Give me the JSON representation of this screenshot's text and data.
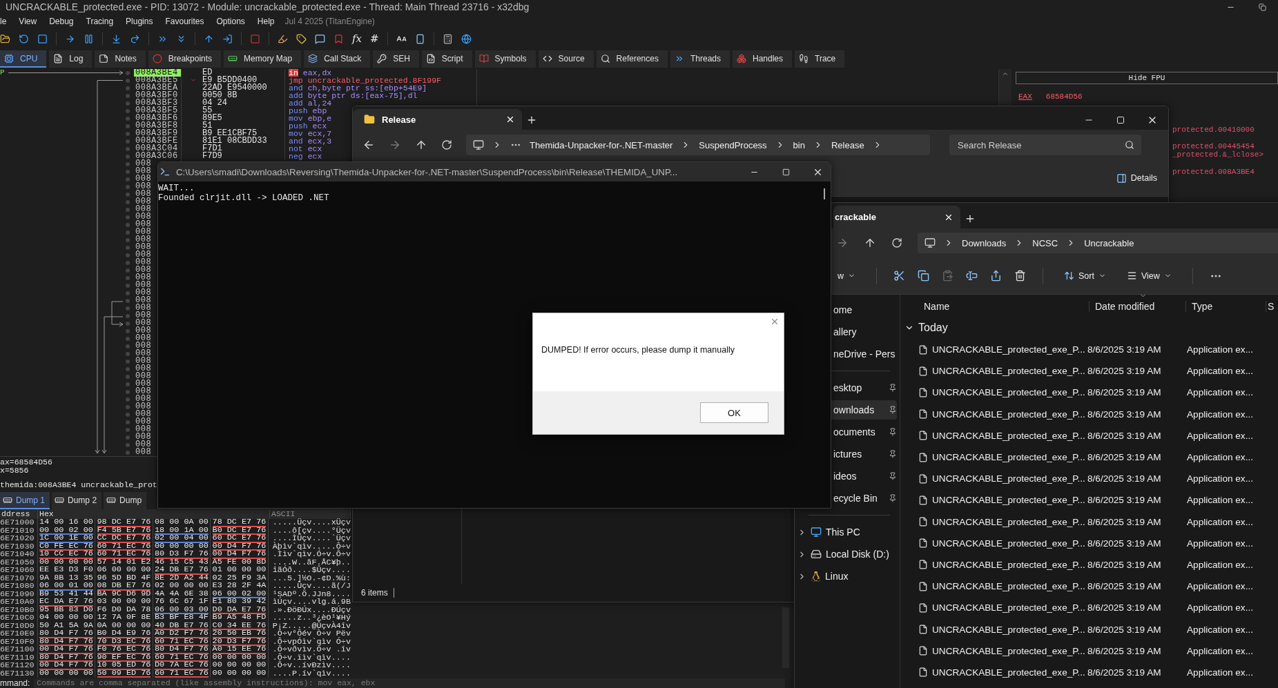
{
  "debugger": {
    "title": "UNCRACKABLE_protected.exe - PID: 13072 - Module: uncrackable_protected.exe - Thread: Main Thread 23716 - x32dbg",
    "menu": [
      "le",
      "View",
      "Debug",
      "Tracing",
      "Plugins",
      "Favourites",
      "Options",
      "Help"
    ],
    "build": "Jul 4 2025 (TitanEngine)",
    "toolbar_glyphs": [
      "fx",
      "#"
    ],
    "tabs": [
      {
        "label": "CPU",
        "selected": true
      },
      {
        "label": "Log",
        "selected": false
      },
      {
        "label": "Notes",
        "selected": false
      },
      {
        "label": "Breakpoints",
        "selected": false
      },
      {
        "label": "Memory Map",
        "selected": false
      },
      {
        "label": "Call Stack",
        "selected": false
      },
      {
        "label": "SEH",
        "selected": false
      },
      {
        "label": "Script",
        "selected": false
      },
      {
        "label": "Symbols",
        "selected": false
      },
      {
        "label": "Source",
        "selected": false
      },
      {
        "label": "References",
        "selected": false
      },
      {
        "label": "Threads",
        "selected": false
      },
      {
        "label": "Handles",
        "selected": false
      },
      {
        "label": "Trace",
        "selected": false
      }
    ],
    "eip_label": "P",
    "disassembly": [
      {
        "address": "008A3BE4",
        "bytes": "ED",
        "mnemonic": "in",
        "operands": "eax,dx",
        "kind": "io",
        "selected": true
      },
      {
        "address": "008A3BE5",
        "bytes": "E9 B5DD0400",
        "mnemonic": "jmp",
        "operands": "uncrackable_protected.8F199F",
        "kind": "jump",
        "selected": false
      },
      {
        "address": "008A3BEA",
        "bytes": "22AD E9540000",
        "mnemonic": "and",
        "operands": "ch,byte ptr ss:[ebp+54E9]",
        "kind": "normal",
        "selected": false
      },
      {
        "address": "008A3BF0",
        "bytes": "0050 8B",
        "mnemonic": "add",
        "operands": "byte ptr ds:[eax-75],dl",
        "kind": "normal",
        "selected": false
      },
      {
        "address": "008A3BF3",
        "bytes": "04 24",
        "mnemonic": "add",
        "operands": "al,24",
        "kind": "normal",
        "selected": false
      },
      {
        "address": "008A3BF5",
        "bytes": "55",
        "mnemonic": "push",
        "operands": "ebp",
        "kind": "normal",
        "selected": false
      },
      {
        "address": "008A3BF6",
        "bytes": "89E5",
        "mnemonic": "mov",
        "operands": "ebp,e",
        "kind": "normal",
        "selected": false
      },
      {
        "address": "008A3BF8",
        "bytes": "51",
        "mnemonic": "push",
        "operands": "ecx",
        "kind": "normal",
        "selected": false
      },
      {
        "address": "008A3BF9",
        "bytes": "B9 EE1CBF75",
        "mnemonic": "mov",
        "operands": "ecx,7",
        "kind": "normal",
        "selected": false
      },
      {
        "address": "008A3BFE",
        "bytes": "81E1 08CBDD33",
        "mnemonic": "and",
        "operands": "ecx,3",
        "kind": "normal",
        "selected": false
      },
      {
        "address": "008A3C04",
        "bytes": "F7D1",
        "mnemonic": "not",
        "operands": "ecx",
        "kind": "normal",
        "selected": false
      },
      {
        "address": "008A3C06",
        "bytes": "F7D9",
        "mnemonic": "neg",
        "operands": "ecx",
        "kind": "normal",
        "selected": false
      },
      {
        "address": "008",
        "selected": false
      },
      {
        "address": "008",
        "selected": false
      },
      {
        "address": "008",
        "selected": false
      },
      {
        "address": "008",
        "selected": false
      },
      {
        "address": "008",
        "selected": false
      },
      {
        "address": "008",
        "selected": false
      },
      {
        "address": "008",
        "selected": false
      },
      {
        "address": "008",
        "selected": false
      },
      {
        "address": "008",
        "selected": false
      },
      {
        "address": "008",
        "selected": false
      },
      {
        "address": "008",
        "selected": false
      },
      {
        "address": "008",
        "selected": false
      },
      {
        "address": "008",
        "selected": false
      },
      {
        "address": "008",
        "selected": false
      },
      {
        "address": "008",
        "selected": false
      },
      {
        "address": "008",
        "selected": false
      },
      {
        "address": "008",
        "selected": false
      },
      {
        "address": "008",
        "selected": false
      },
      {
        "address": "008",
        "selected": false
      },
      {
        "address": "008",
        "selected": false
      },
      {
        "address": "008",
        "selected": false
      },
      {
        "address": "008",
        "selected": false
      },
      {
        "address": "008",
        "selected": false
      },
      {
        "address": "008",
        "selected": false
      },
      {
        "address": "008",
        "selected": false
      },
      {
        "address": "008",
        "selected": false
      },
      {
        "address": "008",
        "selected": false
      },
      {
        "address": "008",
        "selected": false
      },
      {
        "address": "008",
        "selected": false
      },
      {
        "address": "008",
        "selected": false
      },
      {
        "address": "008",
        "selected": false
      },
      {
        "address": "008",
        "selected": false
      },
      {
        "address": "008",
        "selected": false
      },
      {
        "address": "008",
        "selected": false
      },
      {
        "address": "008",
        "selected": false
      },
      {
        "address": "008",
        "selected": false
      },
      {
        "address": "008",
        "selected": false
      },
      {
        "address": "008",
        "selected": false
      },
      {
        "address": "008",
        "selected": false
      }
    ],
    "registers": {
      "header": "Hide FPU",
      "name": "EAX",
      "value": "68584D56",
      "comments": [
        "protected.00410000",
        "protected.00445454",
        "_protected.&_lclose>",
        "protected.008A3BE4"
      ]
    },
    "info_lines": [
      "ax=68584D56",
      "x=5856",
      "themida:008A3BE4 uncrackable_prot"
    ],
    "dump_tabs": [
      {
        "label": "Dump 1",
        "selected": true
      },
      {
        "label": "Dump 2",
        "selected": false
      },
      {
        "label": "Dump",
        "selected": false
      }
    ],
    "dump": {
      "columns": [
        "ddress",
        "Hex",
        "ASCII"
      ],
      "rows": [
        {
          "address": "6E71000",
          "groups": [
            {
              "hex": "14 00 16 00"
            },
            {
              "hex": "98 DC E7 76",
              "color": "#e04a4a"
            },
            {
              "hex": "08 00 0A 00"
            },
            {
              "hex": "78 DC E7 76",
              "color": "#e04a4a"
            }
          ],
          "ascii": ".....Üçv....xÜçv"
        },
        {
          "address": "6E71010",
          "groups": [
            {
              "hex": "00 00 02 00",
              "color": "#5a7fd6"
            },
            {
              "hex": "F4 5B E7 76",
              "color": "#e04a4a"
            },
            {
              "hex": "18 00 1A 00",
              "color": "#5a7fd6"
            },
            {
              "hex": "B0 DC E7 76",
              "color": "#e04a4a"
            }
          ],
          "ascii": "....ô[çv....°Üçv"
        },
        {
          "address": "6E71020",
          "groups": [
            {
              "hex": "1C 00 1E 00",
              "color": "#5a7fd6"
            },
            {
              "hex": "CC DC E7 76",
              "color": "#e04a4a"
            },
            {
              "hex": "02 00 04 00",
              "color": "#5a7fd6"
            },
            {
              "hex": "60 DC E7 76",
              "color": "#e04a4a"
            }
          ],
          "ascii": "....ÌÜçv....`Üçv"
        },
        {
          "address": "6E71030",
          "groups": [
            {
              "hex": "C0 FE EC 76",
              "color": "#e04a4a"
            },
            {
              "hex": "60 71 EC 76",
              "color": "#e04a4a"
            },
            {
              "hex": "00 00 00 00"
            },
            {
              "hex": "00 D4 F7 76",
              "color": "#e04a4a"
            }
          ],
          "ascii": "Àþìv`qìv.....Ô÷v"
        },
        {
          "address": "6E71040",
          "groups": [
            {
              "hex": "10 CC EC 76",
              "color": "#e04a4a"
            },
            {
              "hex": "60 71 EC 76",
              "color": "#e04a4a"
            },
            {
              "hex": "80 D3 F7 76",
              "color": "#e04a4a"
            },
            {
              "hex": "00 D4 F7 76",
              "color": "#e04a4a"
            }
          ],
          "ascii": ".Ììv`qìv.Ó÷v.Ô÷v"
        },
        {
          "address": "6E71050",
          "groups": [
            {
              "hex": "00 00 00 00"
            },
            {
              "hex": "57 14 01 E2"
            },
            {
              "hex": "46 15 C5 43"
            },
            {
              "hex": "A5 FE 00 8D"
            }
          ],
          "ascii": "....W..âF.ÅC¥þ.."
        },
        {
          "address": "6E71060",
          "groups": [
            {
              "hex": "EE E3 D3 F0"
            },
            {
              "hex": "06 00 00 00"
            },
            {
              "hex": "24 DB E7 76",
              "color": "#e04a4a"
            },
            {
              "hex": "01 00 00 00"
            }
          ],
          "ascii": "îãÓð....$Ûçv...."
        },
        {
          "address": "6E71070",
          "groups": [
            {
              "hex": "9A 8B 13 35"
            },
            {
              "hex": "96 5D BD 4F"
            },
            {
              "hex": "8E 2D A2 44"
            },
            {
              "hex": "02 25 F9 3A"
            }
          ],
          "ascii": "...5.]½O.-¢D.%ù:"
        },
        {
          "address": "6E71080",
          "groups": [
            {
              "hex": "06 00 01 00",
              "color": "#5a7fd6"
            },
            {
              "hex": "08 DB E7 76",
              "color": "#e04a4a"
            },
            {
              "hex": "02 00 00 00"
            },
            {
              "hex": "E3 28 2F 4A"
            }
          ],
          "ascii": ".....Ûçv....ã(/J"
        },
        {
          "address": "6E71090",
          "groups": [
            {
              "hex": "B9 53 41 44"
            },
            {
              "hex": "BA 9C D6 9D"
            },
            {
              "hex": "4A 4A 6E 38"
            },
            {
              "hex": "06 00 02 00",
              "color": "#5a7fd6"
            }
          ],
          "ascii": "¹SADº.Ö.JJn8...."
        },
        {
          "address": "6E710A0",
          "groups": [
            {
              "hex": "EC DA E7 76",
              "color": "#e04a4a"
            },
            {
              "hex": "03 00 00 00"
            },
            {
              "hex": "76 6C 67 1F"
            },
            {
              "hex": "E1 80 39 42"
            }
          ],
          "ascii": "ìÚçv....vlg.á.9B"
        },
        {
          "address": "6E710B0",
          "groups": [
            {
              "hex": "95 BB 83 D0"
            },
            {
              "hex": "F6 D0 DA 78"
            },
            {
              "hex": "06 00 03 00",
              "color": "#5a7fd6"
            },
            {
              "hex": "D0 DA E7 76",
              "color": "#e04a4a"
            }
          ],
          "ascii": ".».ÐöÐÚx....ÐÚçv"
        },
        {
          "address": "6E710C0",
          "groups": [
            {
              "hex": "04 00 00 00"
            },
            {
              "hex": "12 7A 0F 8E"
            },
            {
              "hex": "B3 BF E8 4F"
            },
            {
              "hex": "B9 A5 48 FD"
            }
          ],
          "ascii": ".....z..³¿èO¹¥Hý"
        },
        {
          "address": "6E710D0",
          "groups": [
            {
              "hex": "50 A1 5A 9A"
            },
            {
              "hex": "0A 00 00 00"
            },
            {
              "hex": "40 DB E7 76",
              "color": "#e04a4a"
            },
            {
              "hex": "C0 34 EE 76",
              "color": "#e04a4a"
            }
          ],
          "ascii": "P¡Z.....@ÛçvÀ4îv"
        },
        {
          "address": "6E710E0",
          "groups": [
            {
              "hex": "80 D4 F7 76",
              "color": "#e04a4a"
            },
            {
              "hex": "B0 D4 E9 76",
              "color": "#e04a4a"
            },
            {
              "hex": "A0 D2 F7 76",
              "color": "#e04a4a"
            },
            {
              "hex": "20 50 EB 76",
              "color": "#e04a4a"
            }
          ],
          "ascii": ".Ô÷v°Ôév Ò÷v Pëv"
        },
        {
          "address": "6E710F0",
          "groups": [
            {
              "hex": "80 D4 F7 76",
              "color": "#e04a4a"
            },
            {
              "hex": "70 D3 EC 76",
              "color": "#e04a4a"
            },
            {
              "hex": "60 71 EC 76",
              "color": "#e04a4a"
            },
            {
              "hex": "20 D3 F7 76",
              "color": "#e04a4a"
            }
          ],
          "ascii": ".Ô÷vpÓìv`qìv Ó÷v"
        },
        {
          "address": "6E71100",
          "groups": [
            {
              "hex": "00 D4 F7 76",
              "color": "#e04a4a"
            },
            {
              "hex": "F0 76 EC 76",
              "color": "#e04a4a"
            },
            {
              "hex": "80 D4 F7 76",
              "color": "#e04a4a"
            },
            {
              "hex": "A0 15 EE 76",
              "color": "#e04a4a"
            }
          ],
          "ascii": ".Ô÷vðvìv.Ô÷v .îv"
        },
        {
          "address": "6E71110",
          "groups": [
            {
              "hex": "80 D4 F7 76",
              "color": "#e04a4a"
            },
            {
              "hex": "90 EF EC 76",
              "color": "#e04a4a"
            },
            {
              "hex": "60 71 EC 76",
              "color": "#e04a4a"
            },
            {
              "hex": "00 00 00 00"
            }
          ],
          "ascii": ".Ô÷v.ïìv`qìv...."
        },
        {
          "address": "6E71120",
          "groups": [
            {
              "hex": "00 D4 F7 76",
              "color": "#e04a4a"
            },
            {
              "hex": "10 05 ED 76",
              "color": "#e04a4a"
            },
            {
              "hex": "D0 7A EC 76",
              "color": "#e04a4a"
            },
            {
              "hex": "00 00 00 00"
            }
          ],
          "ascii": ".Ô÷v..ívÐzìv...."
        },
        {
          "address": "6E71130",
          "groups": [
            {
              "hex": "00 00 00 00"
            },
            {
              "hex": "50 09 ED 76",
              "color": "#e04a4a"
            },
            {
              "hex": "60 71 EC 76",
              "color": "#e04a4a"
            },
            {
              "hex": "00 00 00 00"
            }
          ],
          "ascii": "....P.ív`qìv...."
        }
      ]
    },
    "command": {
      "label": "mmand:",
      "placeholder": "Commands are comma separated (like assembly instructions): mov eax, ebx"
    }
  },
  "release_window": {
    "tab": "Release",
    "path": [
      "Themida-Unpacker-for-.NET-master",
      "SuspendProcess",
      "bin",
      "Release"
    ],
    "search": {
      "placeholder": "Search Release"
    },
    "details": "Details",
    "status": "6 items"
  },
  "uncrackable_window": {
    "tab": "crackable",
    "path": [
      "Downloads",
      "NCSC",
      "Uncrackable"
    ],
    "new_label": "w",
    "sort": "Sort",
    "view": "View",
    "nav_top": [
      {
        "label": "ome",
        "pinned": false,
        "selected": false
      },
      {
        "label": "allery",
        "pinned": false,
        "selected": false
      },
      {
        "label": "neDrive - Pers",
        "pinned": false,
        "selected": false
      },
      {
        "label": "esktop",
        "pinned": true,
        "selected": false
      },
      {
        "label": "ownloads",
        "pinned": true,
        "selected": true
      },
      {
        "label": "ocuments",
        "pinned": true,
        "selected": false
      },
      {
        "label": "ictures",
        "pinned": true,
        "selected": false
      },
      {
        "label": "ideos",
        "pinned": true,
        "selected": false
      },
      {
        "label": "ecycle Bin",
        "pinned": true,
        "selected": false
      }
    ],
    "nav_bottom": [
      {
        "label": "This PC",
        "kind": "pc"
      },
      {
        "label": "Local Disk (D:)",
        "kind": "disk"
      },
      {
        "label": "Linux",
        "kind": "linux"
      }
    ],
    "columns": [
      "Name",
      "Date modified",
      "Type",
      "S"
    ],
    "group": "Today",
    "files": [
      {
        "name": "UNCRACKABLE_protected_exe_P...",
        "date": "8/6/2025 3:19 AM",
        "type": "Application ex..."
      },
      {
        "name": "UNCRACKABLE_protected_exe_P...",
        "date": "8/6/2025 3:19 AM",
        "type": "Application ex..."
      },
      {
        "name": "UNCRACKABLE_protected_exe_P...",
        "date": "8/6/2025 3:19 AM",
        "type": "Application ex..."
      },
      {
        "name": "UNCRACKABLE_protected_exe_P...",
        "date": "8/6/2025 3:19 AM",
        "type": "Application ex..."
      },
      {
        "name": "UNCRACKABLE_protected_exe_P...",
        "date": "8/6/2025 3:19 AM",
        "type": "Application ex..."
      },
      {
        "name": "UNCRACKABLE_protected_exe_P...",
        "date": "8/6/2025 3:19 AM",
        "type": "Application ex..."
      },
      {
        "name": "UNCRACKABLE_protected_exe_P...",
        "date": "8/6/2025 3:19 AM",
        "type": "Application ex..."
      },
      {
        "name": "UNCRACKABLE_protected_exe_P...",
        "date": "8/6/2025 3:19 AM",
        "type": "Application ex..."
      },
      {
        "name": "UNCRACKABLE_protected_exe_P...",
        "date": "8/6/2025 3:19 AM",
        "type": "Application ex..."
      },
      {
        "name": "UNCRACKABLE_protected_exe_P...",
        "date": "8/6/2025 3:19 AM",
        "type": "Application ex..."
      },
      {
        "name": "UNCRACKABLE_protected_exe_P...",
        "date": "8/6/2025 3:19 AM",
        "type": "Application ex..."
      },
      {
        "name": "UNCRACKABLE_protected_exe_P...",
        "date": "8/6/2025 3:19 AM",
        "type": "Application ex..."
      },
      {
        "name": "UNCRACKABLE_protected_exe_P...",
        "date": "8/6/2025 3:19 AM",
        "type": "Application ex..."
      },
      {
        "name": "UNCRACKABLE_protected_exe_P...",
        "date": "8/6/2025 3:19 AM",
        "type": "Application ex..."
      },
      {
        "name": "UNCRACKABLE_protected_exe_P...",
        "date": "8/6/2025 3:19 AM",
        "type": "Application ex..."
      },
      {
        "name": "UNCRACKABLE_protected_exe_P...",
        "date": "8/6/2025 3:19 AM",
        "type": "Application ex..."
      }
    ]
  },
  "console": {
    "title": "C:\\Users\\smadi\\Downloads\\Reversing\\Themida-Unpacker-for-.NET-master\\SuspendProcess\\bin\\Release\\THEMIDA_UNP...",
    "lines": [
      "WAIT...",
      "Founded clrjit.dll -> LOADED .NET"
    ]
  },
  "dialog": {
    "message": "DUMPED! If error occurs, please dump it manually",
    "button": "OK"
  }
}
